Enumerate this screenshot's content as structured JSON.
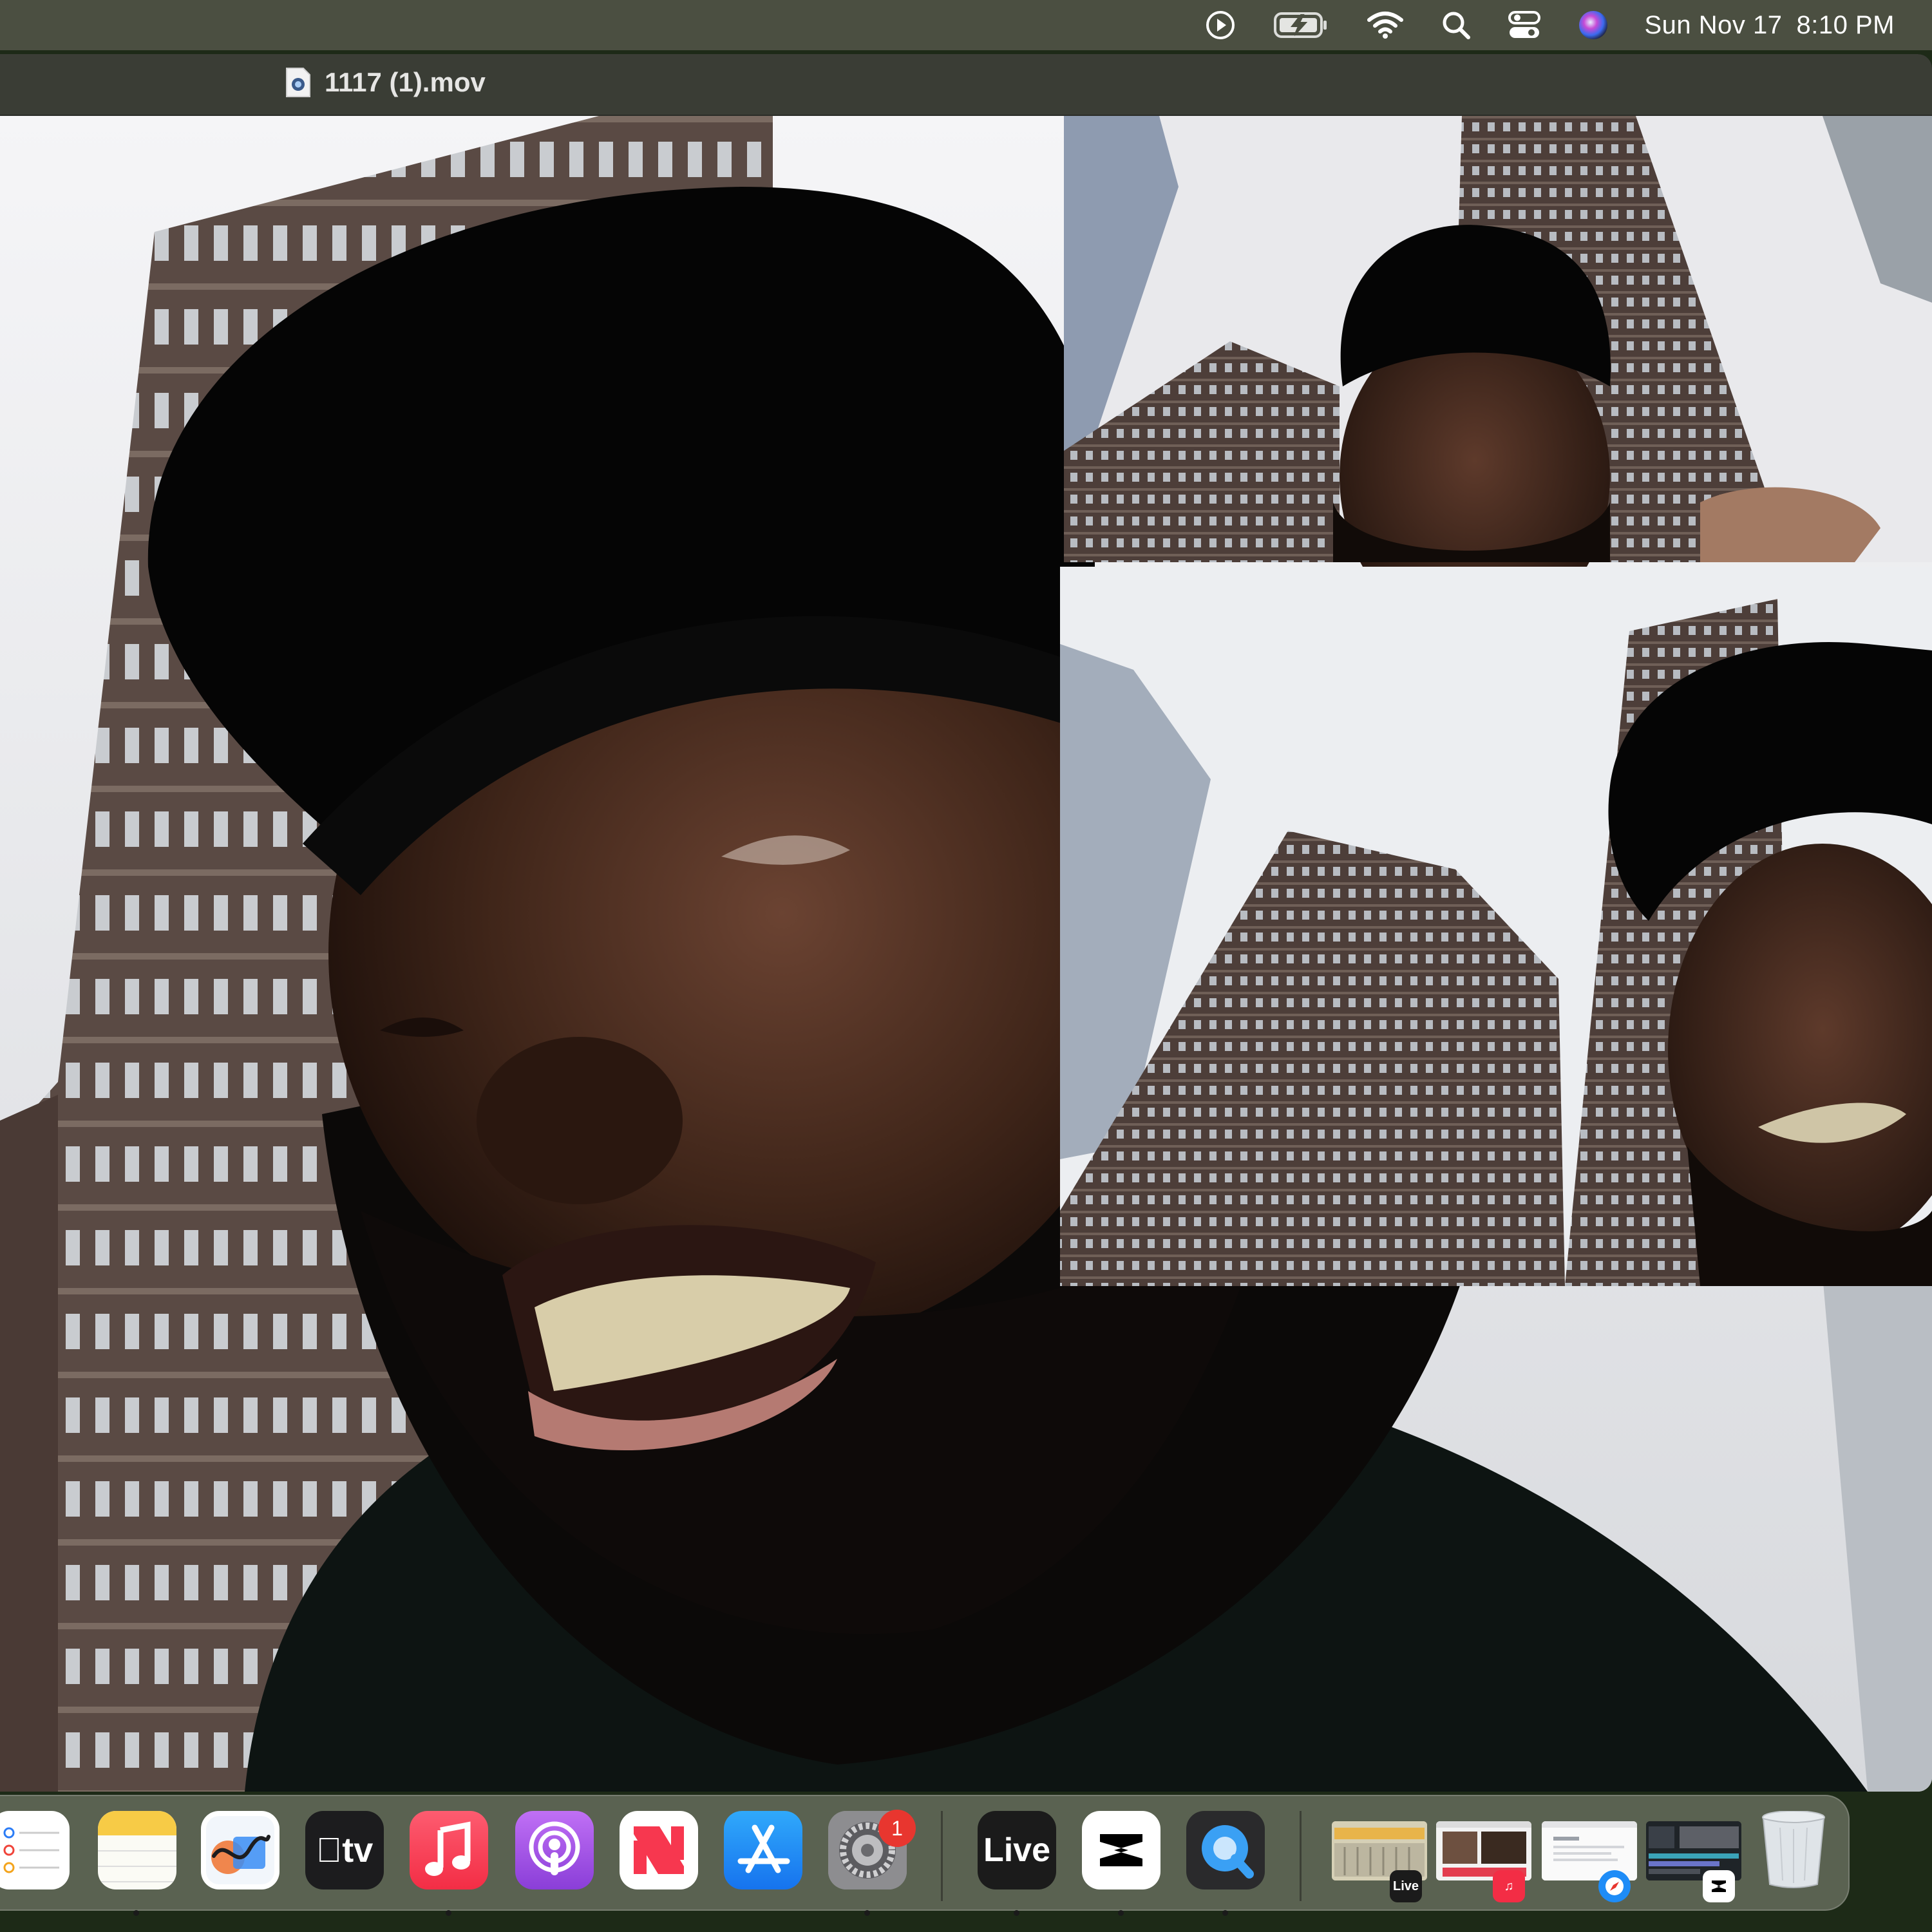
{
  "menubar": {
    "icons": [
      "play-circle-icon",
      "battery-charging-icon",
      "wifi-icon",
      "spotlight-search-icon",
      "control-center-icon",
      "siri-icon"
    ],
    "date": "Sun Nov 17",
    "time": "8:10 PM"
  },
  "window": {
    "title": "1117 (1).mov",
    "title_icon": "document-icon"
  },
  "dock": {
    "apps": [
      {
        "name": "Reminders",
        "icon": "reminders-icon",
        "running": false
      },
      {
        "name": "Notes",
        "icon": "notes-icon",
        "running": true
      },
      {
        "name": "Freeform",
        "icon": "freeform-icon",
        "running": false
      },
      {
        "name": "TV",
        "icon": "apple-tv-icon",
        "label": "tv",
        "running": false
      },
      {
        "name": "Music",
        "icon": "music-icon",
        "running": true
      },
      {
        "name": "Podcasts",
        "icon": "podcasts-icon",
        "running": false
      },
      {
        "name": "News",
        "icon": "news-icon",
        "running": false
      },
      {
        "name": "App Store",
        "icon": "app-store-icon",
        "running": false
      },
      {
        "name": "System Settings",
        "icon": "settings-gear-icon",
        "badge": "1",
        "running": true
      },
      {
        "name": "Ableton Live",
        "icon": "live-icon",
        "label": "Live",
        "running": true
      },
      {
        "name": "CapCut",
        "icon": "capcut-icon",
        "running": true
      },
      {
        "name": "QuickTime Player",
        "icon": "quicktime-icon",
        "running": true
      }
    ],
    "minimized": [
      {
        "icon": "live-window-thumbnail",
        "badge_label": "Live"
      },
      {
        "icon": "music-window-thumbnail",
        "badge_icon": "music-icon"
      },
      {
        "icon": "safari-window-thumbnail",
        "badge_icon": "safari-icon"
      },
      {
        "icon": "capcut-window-thumbnail",
        "badge_icon": "capcut-icon"
      }
    ],
    "trash": {
      "icon": "trash-icon"
    }
  },
  "colors": {
    "menubar_bg": "#4b4f41",
    "dock_bg": "#5f6656",
    "badge_red": "#e8362f",
    "music_red": "#fa2d48",
    "podcasts_purple": "#9b4fdc",
    "appstore_blue": "#1e8cf7"
  }
}
